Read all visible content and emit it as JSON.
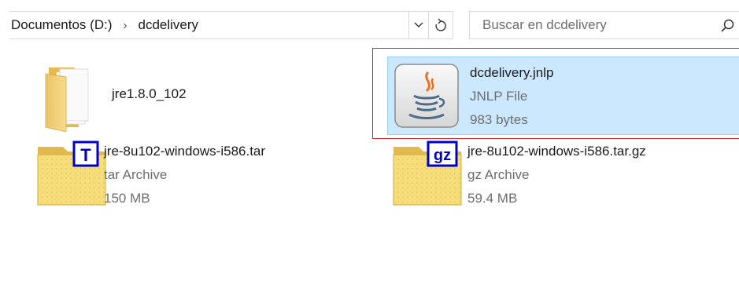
{
  "address": {
    "crumbs": [
      "Documentos (D:)",
      "dcdelivery"
    ],
    "separator": "›"
  },
  "search": {
    "placeholder": "Buscar en dcdelivery"
  },
  "files": [
    {
      "name": "jre1.8.0_102",
      "type": "",
      "size": "",
      "icon": "folder-icon"
    },
    {
      "name": "dcdelivery.jnlp",
      "type": "JNLP File",
      "size": "983 bytes",
      "icon": "java-icon",
      "selected": true
    },
    {
      "name": "jre-8u102-windows-i586.tar",
      "type": "tar Archive",
      "size": "150 MB",
      "icon": "tar-archive-icon",
      "badge": "T"
    },
    {
      "name": "jre-8u102-windows-i586.tar.gz",
      "type": "gz Archive",
      "size": "59.4 MB",
      "icon": "gz-archive-icon",
      "badge": "gz"
    }
  ],
  "colors": {
    "selection_bg": "#cce8ff",
    "selection_border": "#99d1ff",
    "highlight_border": "#d0262b",
    "badge_blue": "#0000cc"
  }
}
